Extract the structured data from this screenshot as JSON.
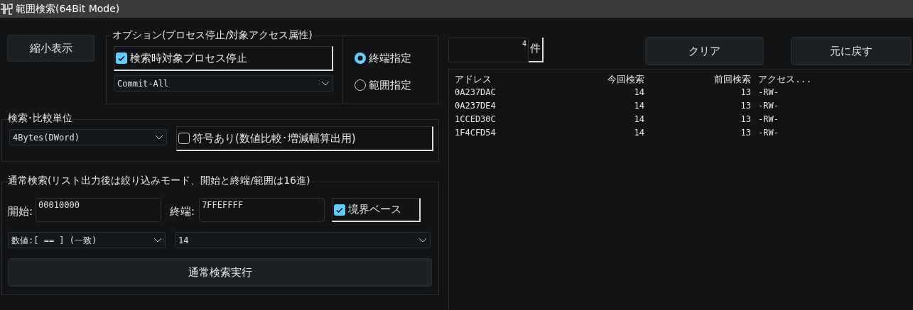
{
  "window": {
    "title": "範囲検索(64Bit Mode)"
  },
  "shrink_button": "縮小表示",
  "options": {
    "legend": "オプション(プロセス停止/対象アクセス属性)",
    "stop_process": {
      "label": "検索時対象プロセス停止",
      "checked": true
    },
    "access_filter": {
      "value": "Commit-All"
    },
    "range_mode": [
      {
        "label": "終端指定",
        "selected": true
      },
      {
        "label": "範囲指定",
        "selected": false
      }
    ]
  },
  "unit": {
    "legend": "検索･比較単位",
    "size": {
      "value": "4Bytes(DWord)"
    },
    "signed": {
      "label": "符号あり(数値比較･増減幅算出用)",
      "checked": false
    }
  },
  "normal_search": {
    "legend": "通常検索(リスト出力後は絞り込みモード、開始と終端/範囲は16進)",
    "start_label": "開始:",
    "start": "00010000",
    "end_label": "終端:",
    "end": "7FFEFFFF",
    "boundary": {
      "label": "境界ベース",
      "checked": true
    },
    "condition": {
      "value": "数値:[ == ] (一致)"
    },
    "value": {
      "value": "14"
    },
    "run_button": "通常検索実行"
  },
  "results": {
    "count": "4",
    "count_unit": "件",
    "clear_button": "クリア",
    "undo_button": "元に戻す",
    "columns": [
      "アドレス",
      "今回検索",
      "前回検索",
      "アクセス..."
    ],
    "rows": [
      [
        "0A237DAC",
        "14",
        "13",
        "-RW-"
      ],
      [
        "0A237DE4",
        "14",
        "13",
        "-RW-"
      ],
      [
        "1CCED30C",
        "14",
        "13",
        "-RW-"
      ],
      [
        "1F4CFD54",
        "14",
        "13",
        "-RW-"
      ]
    ]
  }
}
